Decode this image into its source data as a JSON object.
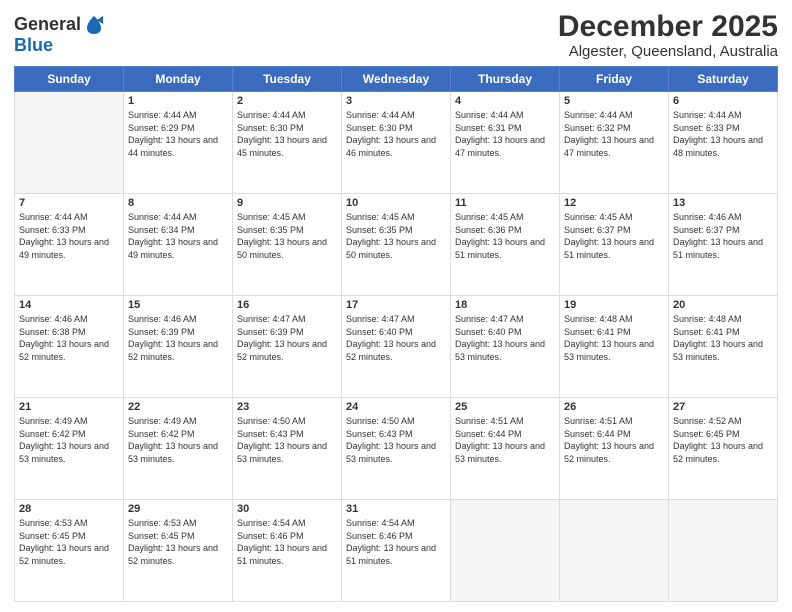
{
  "logo": {
    "general": "General",
    "blue": "Blue"
  },
  "title": "December 2025",
  "subtitle": "Algester, Queensland, Australia",
  "days_header": [
    "Sunday",
    "Monday",
    "Tuesday",
    "Wednesday",
    "Thursday",
    "Friday",
    "Saturday"
  ],
  "weeks": [
    [
      {
        "day": "",
        "empty": true
      },
      {
        "day": "1",
        "sunrise": "Sunrise: 4:44 AM",
        "sunset": "Sunset: 6:29 PM",
        "daylight": "Daylight: 13 hours and 44 minutes."
      },
      {
        "day": "2",
        "sunrise": "Sunrise: 4:44 AM",
        "sunset": "Sunset: 6:30 PM",
        "daylight": "Daylight: 13 hours and 45 minutes."
      },
      {
        "day": "3",
        "sunrise": "Sunrise: 4:44 AM",
        "sunset": "Sunset: 6:30 PM",
        "daylight": "Daylight: 13 hours and 46 minutes."
      },
      {
        "day": "4",
        "sunrise": "Sunrise: 4:44 AM",
        "sunset": "Sunset: 6:31 PM",
        "daylight": "Daylight: 13 hours and 47 minutes."
      },
      {
        "day": "5",
        "sunrise": "Sunrise: 4:44 AM",
        "sunset": "Sunset: 6:32 PM",
        "daylight": "Daylight: 13 hours and 47 minutes."
      },
      {
        "day": "6",
        "sunrise": "Sunrise: 4:44 AM",
        "sunset": "Sunset: 6:33 PM",
        "daylight": "Daylight: 13 hours and 48 minutes."
      }
    ],
    [
      {
        "day": "7",
        "sunrise": "Sunrise: 4:44 AM",
        "sunset": "Sunset: 6:33 PM",
        "daylight": "Daylight: 13 hours and 49 minutes."
      },
      {
        "day": "8",
        "sunrise": "Sunrise: 4:44 AM",
        "sunset": "Sunset: 6:34 PM",
        "daylight": "Daylight: 13 hours and 49 minutes."
      },
      {
        "day": "9",
        "sunrise": "Sunrise: 4:45 AM",
        "sunset": "Sunset: 6:35 PM",
        "daylight": "Daylight: 13 hours and 50 minutes."
      },
      {
        "day": "10",
        "sunrise": "Sunrise: 4:45 AM",
        "sunset": "Sunset: 6:35 PM",
        "daylight": "Daylight: 13 hours and 50 minutes."
      },
      {
        "day": "11",
        "sunrise": "Sunrise: 4:45 AM",
        "sunset": "Sunset: 6:36 PM",
        "daylight": "Daylight: 13 hours and 51 minutes."
      },
      {
        "day": "12",
        "sunrise": "Sunrise: 4:45 AM",
        "sunset": "Sunset: 6:37 PM",
        "daylight": "Daylight: 13 hours and 51 minutes."
      },
      {
        "day": "13",
        "sunrise": "Sunrise: 4:46 AM",
        "sunset": "Sunset: 6:37 PM",
        "daylight": "Daylight: 13 hours and 51 minutes."
      }
    ],
    [
      {
        "day": "14",
        "sunrise": "Sunrise: 4:46 AM",
        "sunset": "Sunset: 6:38 PM",
        "daylight": "Daylight: 13 hours and 52 minutes."
      },
      {
        "day": "15",
        "sunrise": "Sunrise: 4:46 AM",
        "sunset": "Sunset: 6:39 PM",
        "daylight": "Daylight: 13 hours and 52 minutes."
      },
      {
        "day": "16",
        "sunrise": "Sunrise: 4:47 AM",
        "sunset": "Sunset: 6:39 PM",
        "daylight": "Daylight: 13 hours and 52 minutes."
      },
      {
        "day": "17",
        "sunrise": "Sunrise: 4:47 AM",
        "sunset": "Sunset: 6:40 PM",
        "daylight": "Daylight: 13 hours and 52 minutes."
      },
      {
        "day": "18",
        "sunrise": "Sunrise: 4:47 AM",
        "sunset": "Sunset: 6:40 PM",
        "daylight": "Daylight: 13 hours and 53 minutes."
      },
      {
        "day": "19",
        "sunrise": "Sunrise: 4:48 AM",
        "sunset": "Sunset: 6:41 PM",
        "daylight": "Daylight: 13 hours and 53 minutes."
      },
      {
        "day": "20",
        "sunrise": "Sunrise: 4:48 AM",
        "sunset": "Sunset: 6:41 PM",
        "daylight": "Daylight: 13 hours and 53 minutes."
      }
    ],
    [
      {
        "day": "21",
        "sunrise": "Sunrise: 4:49 AM",
        "sunset": "Sunset: 6:42 PM",
        "daylight": "Daylight: 13 hours and 53 minutes."
      },
      {
        "day": "22",
        "sunrise": "Sunrise: 4:49 AM",
        "sunset": "Sunset: 6:42 PM",
        "daylight": "Daylight: 13 hours and 53 minutes."
      },
      {
        "day": "23",
        "sunrise": "Sunrise: 4:50 AM",
        "sunset": "Sunset: 6:43 PM",
        "daylight": "Daylight: 13 hours and 53 minutes."
      },
      {
        "day": "24",
        "sunrise": "Sunrise: 4:50 AM",
        "sunset": "Sunset: 6:43 PM",
        "daylight": "Daylight: 13 hours and 53 minutes."
      },
      {
        "day": "25",
        "sunrise": "Sunrise: 4:51 AM",
        "sunset": "Sunset: 6:44 PM",
        "daylight": "Daylight: 13 hours and 53 minutes."
      },
      {
        "day": "26",
        "sunrise": "Sunrise: 4:51 AM",
        "sunset": "Sunset: 6:44 PM",
        "daylight": "Daylight: 13 hours and 52 minutes."
      },
      {
        "day": "27",
        "sunrise": "Sunrise: 4:52 AM",
        "sunset": "Sunset: 6:45 PM",
        "daylight": "Daylight: 13 hours and 52 minutes."
      }
    ],
    [
      {
        "day": "28",
        "sunrise": "Sunrise: 4:53 AM",
        "sunset": "Sunset: 6:45 PM",
        "daylight": "Daylight: 13 hours and 52 minutes."
      },
      {
        "day": "29",
        "sunrise": "Sunrise: 4:53 AM",
        "sunset": "Sunset: 6:45 PM",
        "daylight": "Daylight: 13 hours and 52 minutes."
      },
      {
        "day": "30",
        "sunrise": "Sunrise: 4:54 AM",
        "sunset": "Sunset: 6:46 PM",
        "daylight": "Daylight: 13 hours and 51 minutes."
      },
      {
        "day": "31",
        "sunrise": "Sunrise: 4:54 AM",
        "sunset": "Sunset: 6:46 PM",
        "daylight": "Daylight: 13 hours and 51 minutes."
      },
      {
        "day": "",
        "empty": true
      },
      {
        "day": "",
        "empty": true
      },
      {
        "day": "",
        "empty": true
      }
    ]
  ]
}
